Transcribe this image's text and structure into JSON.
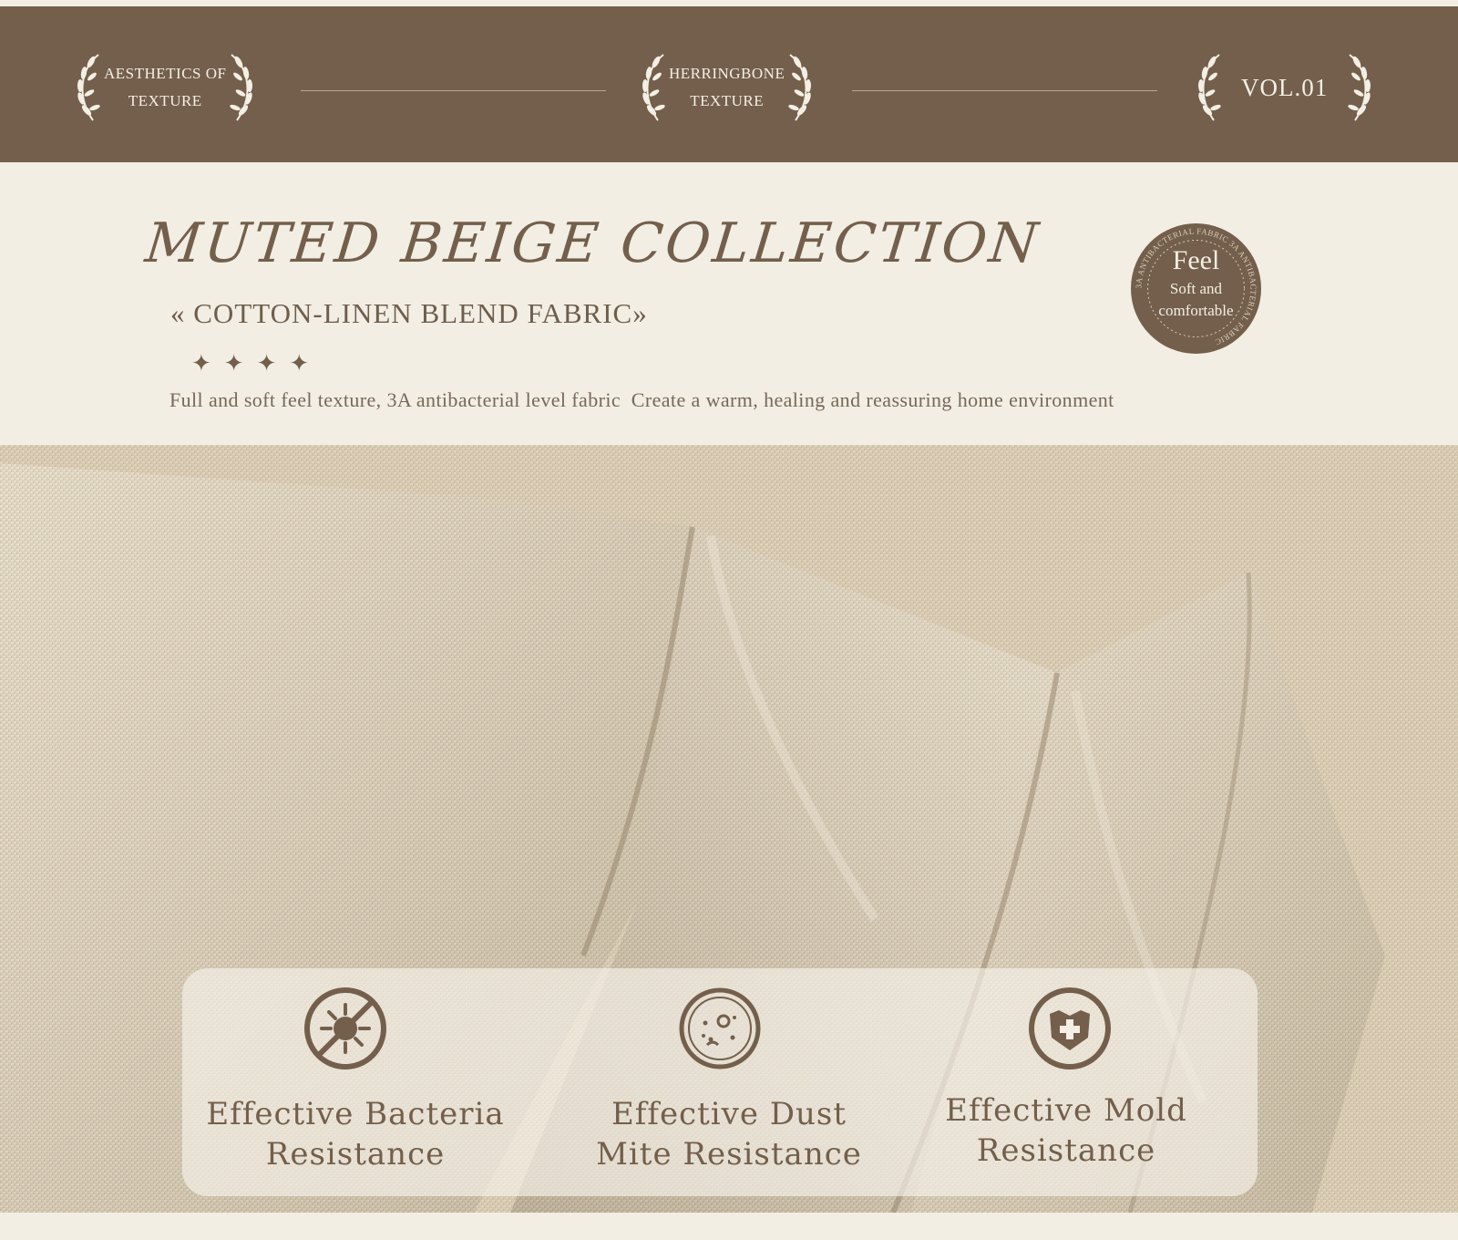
{
  "banner": {
    "left_badge": {
      "line1": "AESTHETICS OF",
      "line2": "TEXTURE"
    },
    "center_badge": {
      "line1": "HERRINGBONE",
      "line2": "TEXTURE"
    },
    "right_badge": {
      "text": "VOL.01"
    },
    "background_color": "#735f4b"
  },
  "header": {
    "title": "MUTED BEIGE COLLECTION",
    "subtitle": "« COTTON-LINEN BLEND FABRIC»",
    "stars": [
      "✦",
      "✦",
      "✦",
      "✦"
    ],
    "tagline": "Full and soft feel texture, 3A antibacterial level fabric  Create a warm, healing and reassuring home environment"
  },
  "feel_badge": {
    "title": "Feel",
    "line1": "Soft and",
    "line2": "comfortable",
    "ring_text": "3A ANTIBACTERIAL FABRIC  3A ANTIBACTERIAL FABRIC"
  },
  "features": [
    {
      "icon": "no-bacteria-icon",
      "line1": "Effective Bacteria",
      "line2": "Resistance"
    },
    {
      "icon": "dust-mite-icon",
      "line1": "Effective Dust",
      "line2": "Mite Resistance"
    },
    {
      "icon": "shield-cross-icon",
      "line1": "Effective Mold",
      "line2": "Resistance"
    }
  ],
  "colors": {
    "brown": "#735f4b",
    "cream": "#f2eee3",
    "linen": "#d8ccb3"
  }
}
